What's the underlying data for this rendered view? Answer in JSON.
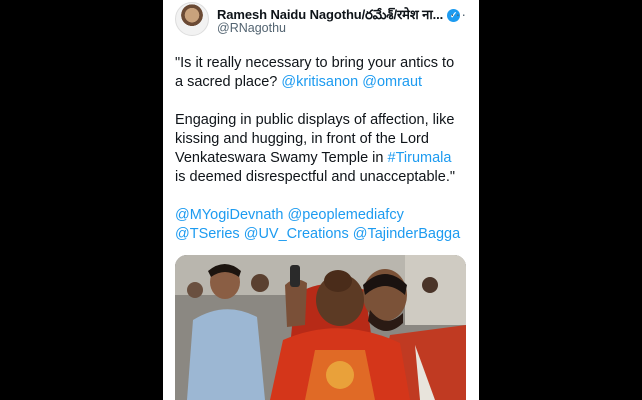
{
  "tweet": {
    "author_name": "Ramesh Naidu Nagothu/రమేశ్/रमेश ना...",
    "handle": "@RNagothu",
    "more_label": "···",
    "verified_glyph": "✓",
    "paragraph1": {
      "text_before": "\"Is it really necessary to bring your antics to a sacred place? ",
      "mention1": "@kritisanon",
      "mention2": "@omraut"
    },
    "paragraph2": {
      "text_before": "Engaging in public displays of affection, like kissing and hugging, in front of the Lord Venkateswara Swamy Temple in ",
      "hashtag": "#Tirumala",
      "text_after": " is deemed disrespectful and unacceptable.\""
    },
    "mentions_line": [
      "@MYogiDevnath",
      "@peoplemediafcy",
      "@TSeries",
      "@UV_Creations",
      "@TajinderBagga"
    ]
  },
  "colors": {
    "link": "#1d9bf0",
    "verified": "#1d9bf0",
    "text": "#0f1419",
    "secondary": "#536471",
    "saree": "#d4361a"
  }
}
